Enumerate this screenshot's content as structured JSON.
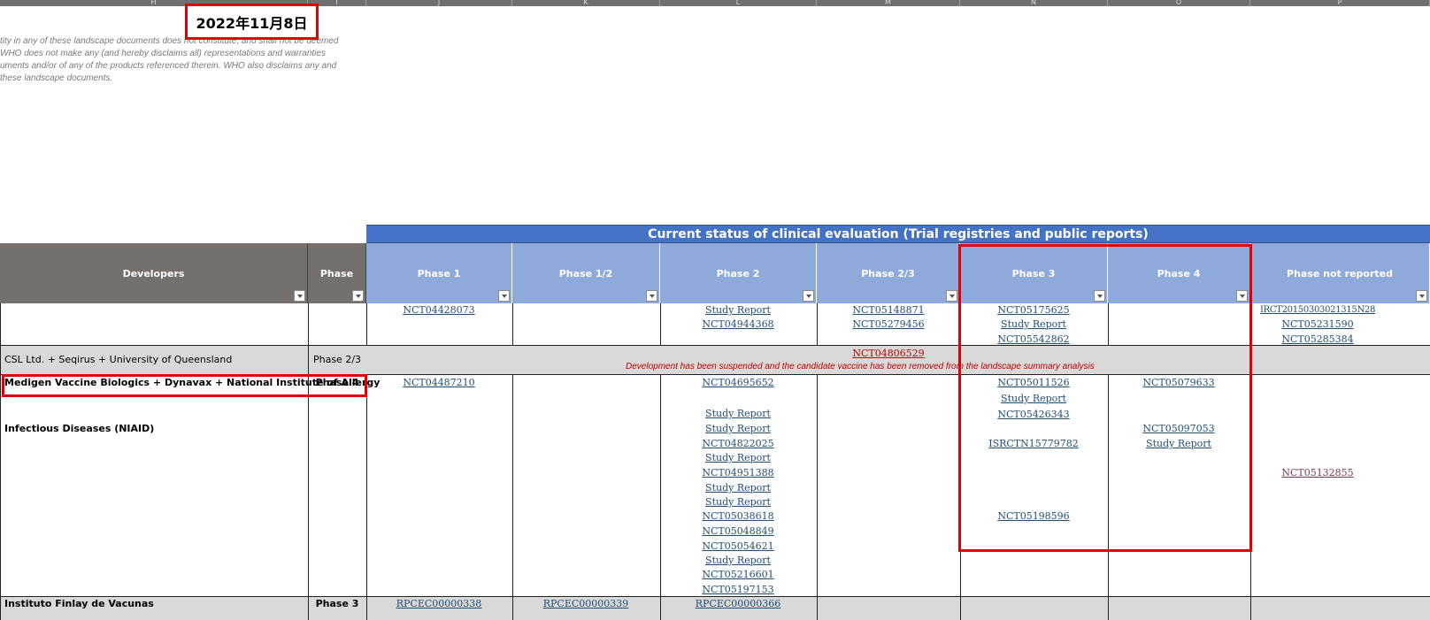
{
  "column_letters": [
    "H",
    "I",
    "J",
    "K",
    "L",
    "M",
    "N",
    "O",
    "P"
  ],
  "date_label": "2022年11月8日",
  "disclaimer_lines": [
    "tity in any of these landscape documents does not constitute, and shall not be deemed",
    "WHO does not make any (and hereby disclaims all) representations and warranties",
    "uments and/or of any of the products referenced therein.  WHO also disclaims any and",
    "these landscape documents."
  ],
  "banner": "Current status of clinical evaluation (Trial registries and public reports)",
  "headers": {
    "developers": "Developers",
    "phase": "Phase",
    "phase1": "Phase 1",
    "phase12": "Phase 1/2",
    "phase2": "Phase 2",
    "phase23": "Phase 2/3",
    "phase3": "Phase 3",
    "phase4": "Phase 4",
    "phase_nr": "Phase not reported"
  },
  "row1": {
    "phase1": [
      "NCT04428073"
    ],
    "phase2": [
      "Study Report",
      "NCT04944368"
    ],
    "phase23": [
      "NCT05148871",
      "NCT05279456"
    ],
    "phase3": [
      "NCT05175625",
      "Study Report",
      "NCT05542862"
    ],
    "phase_nr": [
      "IRCT20150303021315N28",
      "NCT05231590",
      "NCT05285384"
    ]
  },
  "row2": {
    "developer": "CSL Ltd. + Seqirus + University of Queensland",
    "phase": "Phase 2/3",
    "link": "NCT04806529",
    "note": "Development has been suspended and the candidate vaccine has been removed from the landscape summary analysis"
  },
  "row3": {
    "developer_line1": "Medigen Vaccine Biologics + Dynavax + National Institute of Allergy",
    "developer_line2": "Infectious Diseases (NIAID)",
    "phase": "Phase 4",
    "phase1": [
      "NCT04487210"
    ],
    "phase2": [
      "NCT04695652",
      "Study Report",
      "Study Report",
      "NCT04822025",
      "Study Report",
      "NCT04951388",
      "Study Report",
      "Study Report",
      "NCT05038618",
      "NCT05048849",
      "NCT05054621",
      "Study Report",
      "NCT05216601",
      "NCT05197153"
    ],
    "phase3": [
      "NCT05011526",
      "Study Report",
      "NCT05426343",
      "ISRCTN15779782",
      "NCT05198596"
    ],
    "phase4": [
      "NCT05079633",
      "NCT05097053",
      "Study Report"
    ],
    "phase_nr": [
      "NCT05132855"
    ]
  },
  "row4_partial": {
    "developer": "Instituto Finlay de Vacunas",
    "phase": "Phase 3",
    "phase1": "RPCEC00000338",
    "phase12": "RPCEC00000339",
    "phase2": "RPCEC00000366"
  },
  "colors": {
    "banner": "#4472c4",
    "header_blue": "#8eaadb",
    "header_grey": "#75706b",
    "link": "#1f4e79",
    "highlight_red": "#e00000"
  }
}
